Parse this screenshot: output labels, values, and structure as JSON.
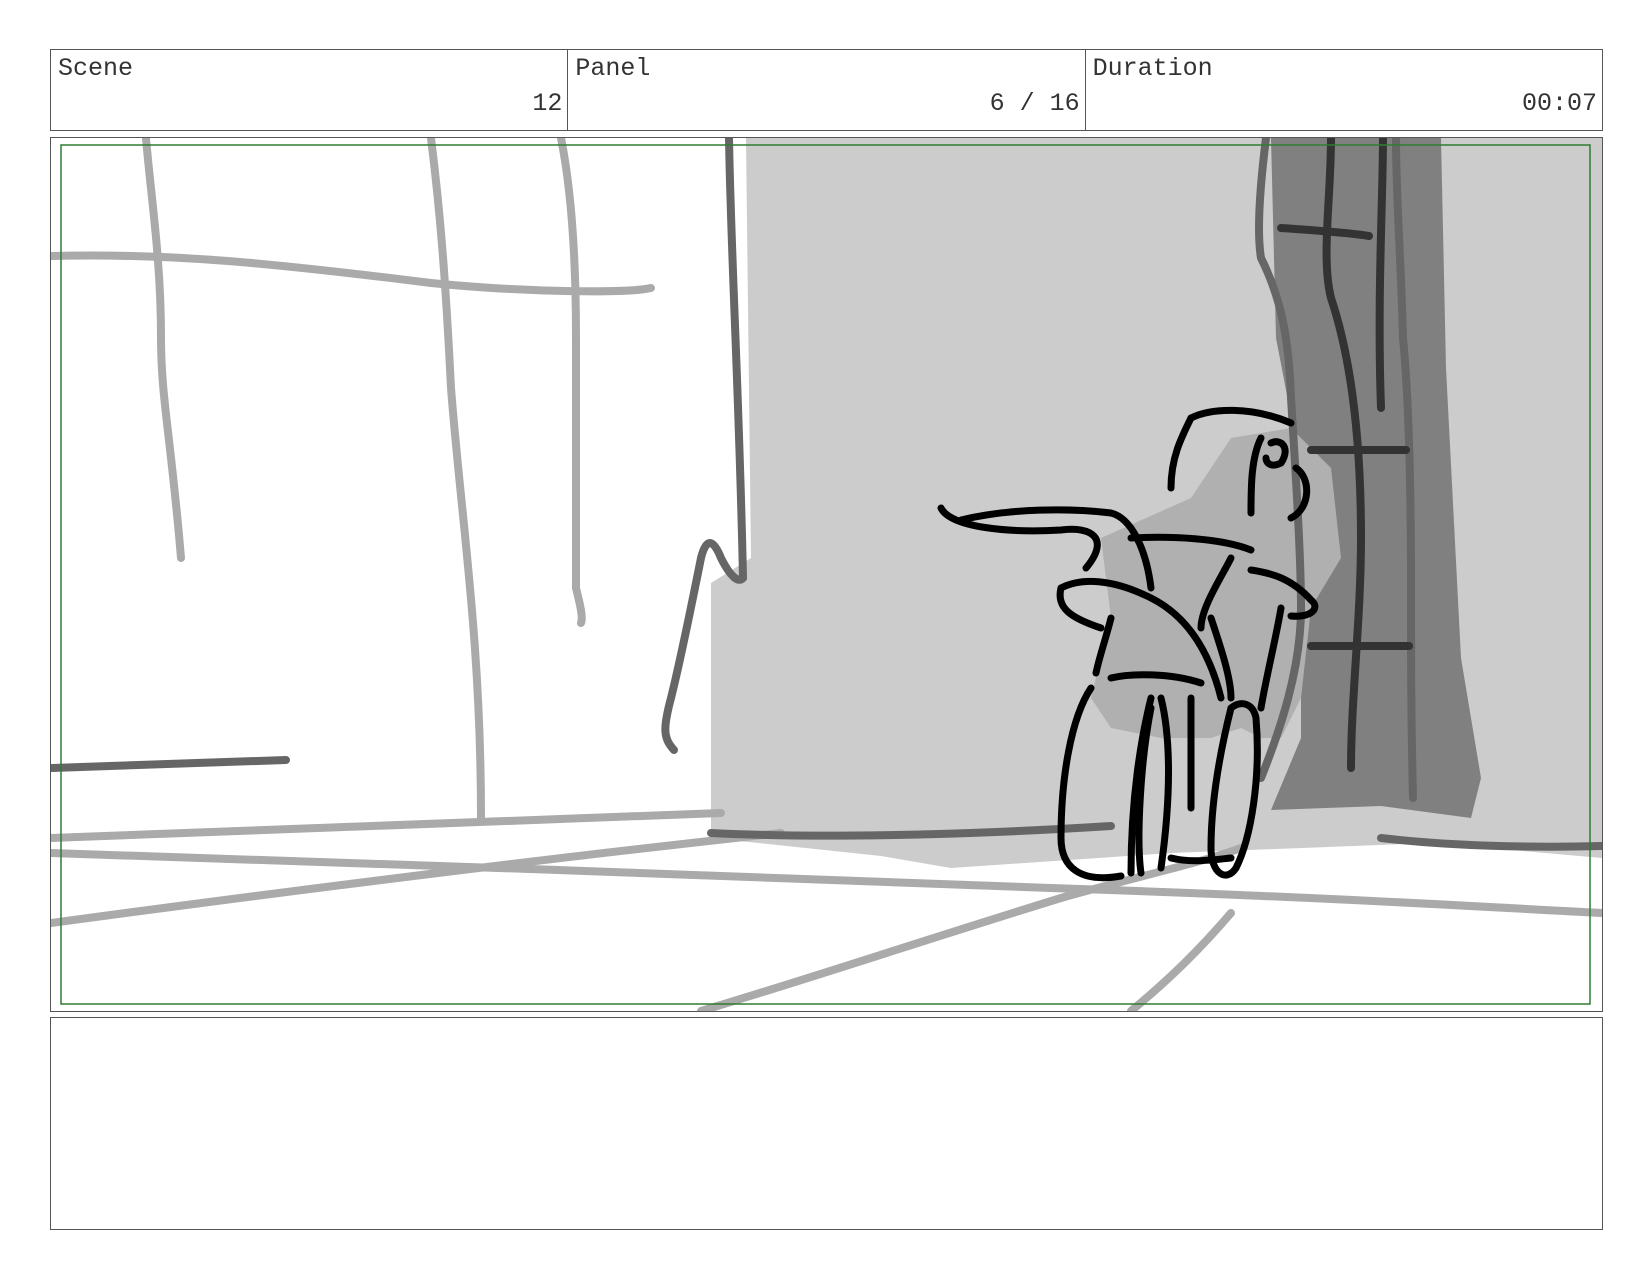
{
  "header": {
    "scene_label": "Scene",
    "scene_value": "12",
    "panel_label": "Panel",
    "panel_value": "6 / 16",
    "duration_label": "Duration",
    "duration_value": "00:07"
  },
  "frame": {
    "safe_area_color": "#2e7d32",
    "sketch_gray_light": "#aaaaaa",
    "sketch_gray_mid": "#666666",
    "sketch_fill_light": "#cccccc",
    "sketch_fill_dark": "#808080",
    "sketch_ink": "#000000"
  },
  "notes": {
    "text": ""
  }
}
